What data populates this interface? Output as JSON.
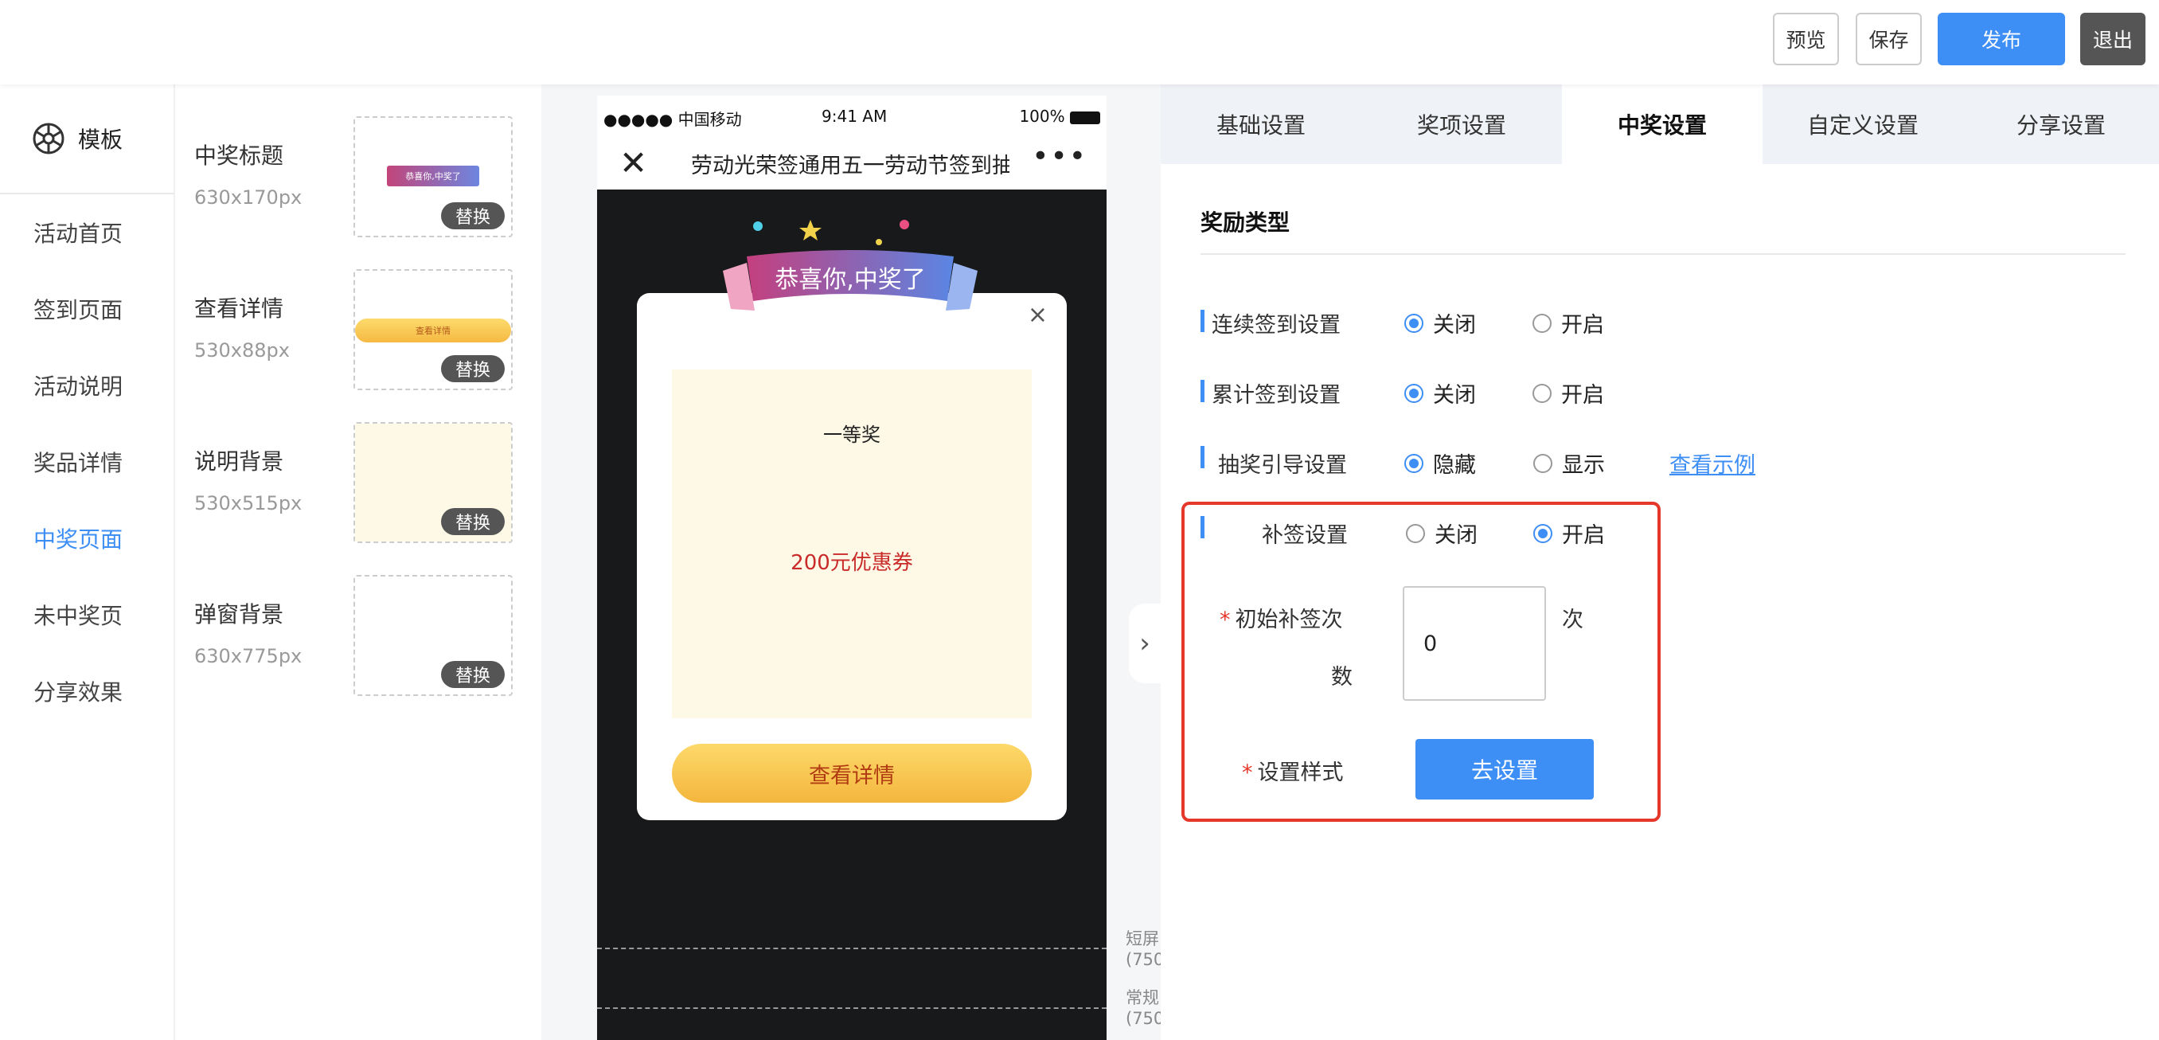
{
  "toolbar": {
    "preview": "预览",
    "save": "保存",
    "publish": "发布",
    "exit": "退出"
  },
  "sidebar": {
    "title": "模板",
    "items": [
      {
        "label": "活动首页",
        "active": false
      },
      {
        "label": "签到页面",
        "active": false
      },
      {
        "label": "活动说明",
        "active": false
      },
      {
        "label": "奖品详情",
        "active": false
      },
      {
        "label": "中奖页面",
        "active": true
      },
      {
        "label": "未中奖页",
        "active": false
      },
      {
        "label": "分享效果",
        "active": false
      }
    ]
  },
  "assets": [
    {
      "title": "中奖标题",
      "size": "630x170px",
      "replace": "替换",
      "thumb_text": "恭喜你,中奖了"
    },
    {
      "title": "查看详情",
      "size": "530x88px",
      "replace": "替换",
      "thumb_text": "查看详情"
    },
    {
      "title": "说明背景",
      "size": "530x515px",
      "replace": "替换"
    },
    {
      "title": "弹窗背景",
      "size": "630x775px",
      "replace": "替换"
    }
  ],
  "phone": {
    "carrier": "●●●●● 中国移动",
    "time": "9:41 AM",
    "battery": "100%",
    "nav_title": "劳动光荣签通用五一劳动节签到抽奖",
    "close_glyph": "✕",
    "more_glyph": "•••",
    "ribbon_text": "恭喜你,中奖了",
    "prize_level": "一等奖",
    "prize_name": "200元优惠券",
    "detail_button": "查看详情",
    "popup_close": "×",
    "screen_tag_short": [
      "短屏",
      "(750"
    ],
    "screen_tag_regular": [
      "常规",
      "(750"
    ]
  },
  "settings": {
    "tabs": [
      "基础设置",
      "奖项设置",
      "中奖设置",
      "自定义设置",
      "分享设置"
    ],
    "active_tab": 2,
    "section_title": "奖励类型",
    "rows": {
      "continuous": {
        "label": "连续签到设置",
        "opt1": "关闭",
        "opt2": "开启",
        "selected": 1
      },
      "cumulative": {
        "label": "累计签到设置",
        "opt1": "关闭",
        "opt2": "开启",
        "selected": 1
      },
      "guide": {
        "label": "抽奖引导设置",
        "opt1": "隐藏",
        "opt2": "显示",
        "selected": 1,
        "link": "查看示例"
      },
      "makeup": {
        "label": "补签设置",
        "opt1": "关闭",
        "opt2": "开启",
        "selected": 2
      }
    },
    "initial_count": {
      "label_line1": "初始补签次",
      "label_line2": "数",
      "value": "0",
      "unit": "次",
      "required_mark": "*"
    },
    "style": {
      "label": "设置样式",
      "button": "去设置",
      "required_mark": "*"
    }
  },
  "colors": {
    "accent": "#3d8ef5",
    "alert": "#e5382b",
    "coupon": "#c92a2a"
  }
}
